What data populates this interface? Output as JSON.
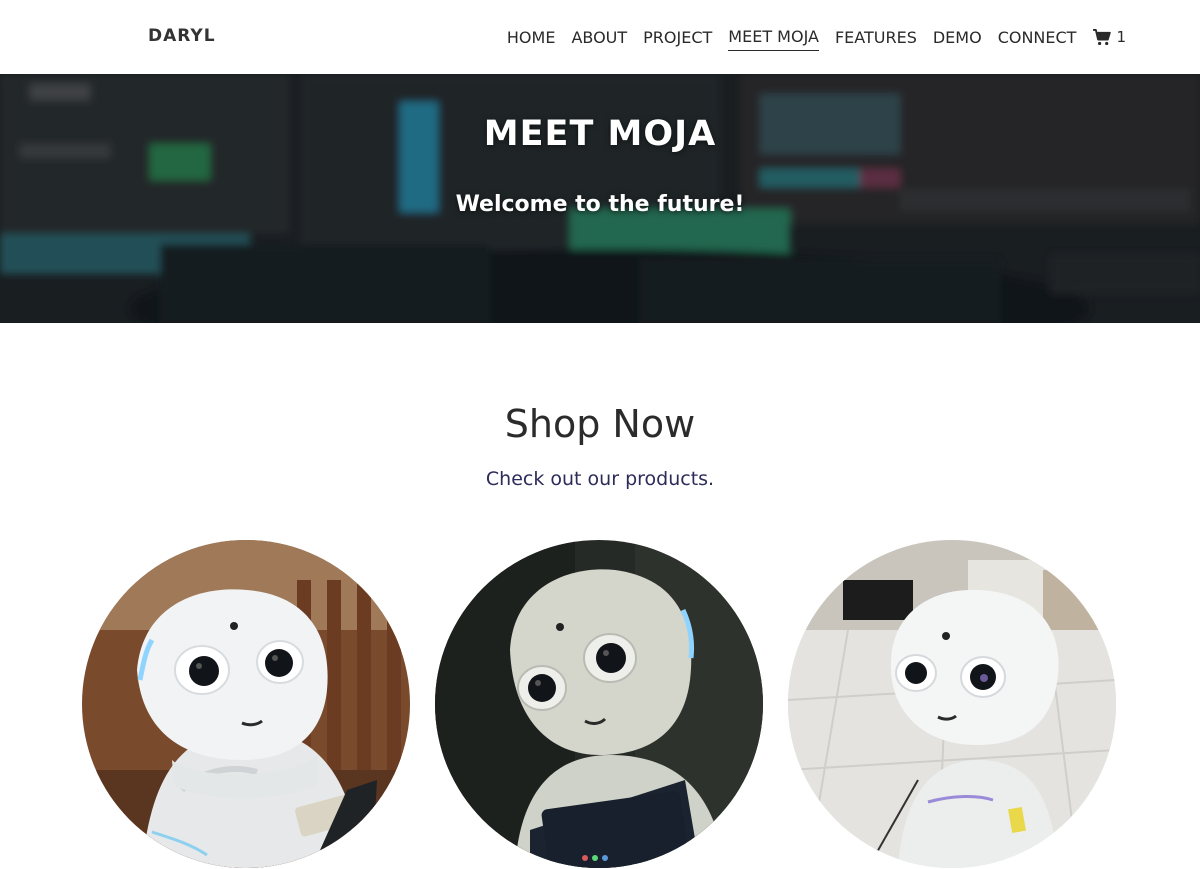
{
  "navbar": {
    "brand": "DARYL",
    "links": [
      {
        "label": "HOME"
      },
      {
        "label": "ABOUT"
      },
      {
        "label": "PROJECT"
      },
      {
        "label": "MEET MOJA",
        "active": true
      },
      {
        "label": "FEATURES"
      },
      {
        "label": "DEMO"
      },
      {
        "label": "CONNECT"
      }
    ],
    "cart": {
      "icon": "shopping-cart-icon",
      "count": "1"
    }
  },
  "hero": {
    "title": "MEET MOJA",
    "subtitle": "Welcome to the future!"
  },
  "shop": {
    "title": "Shop Now",
    "subtitle": "Check out our products."
  },
  "products": [
    {
      "image": "robot-photo-wood-background"
    },
    {
      "image": "robot-photo-dark-background"
    },
    {
      "image": "robot-photo-mall-background"
    }
  ],
  "colors": {
    "text": "#2b2b2b",
    "subtitle": "#2c2b5a",
    "hero_overlay": "#1b2024"
  }
}
